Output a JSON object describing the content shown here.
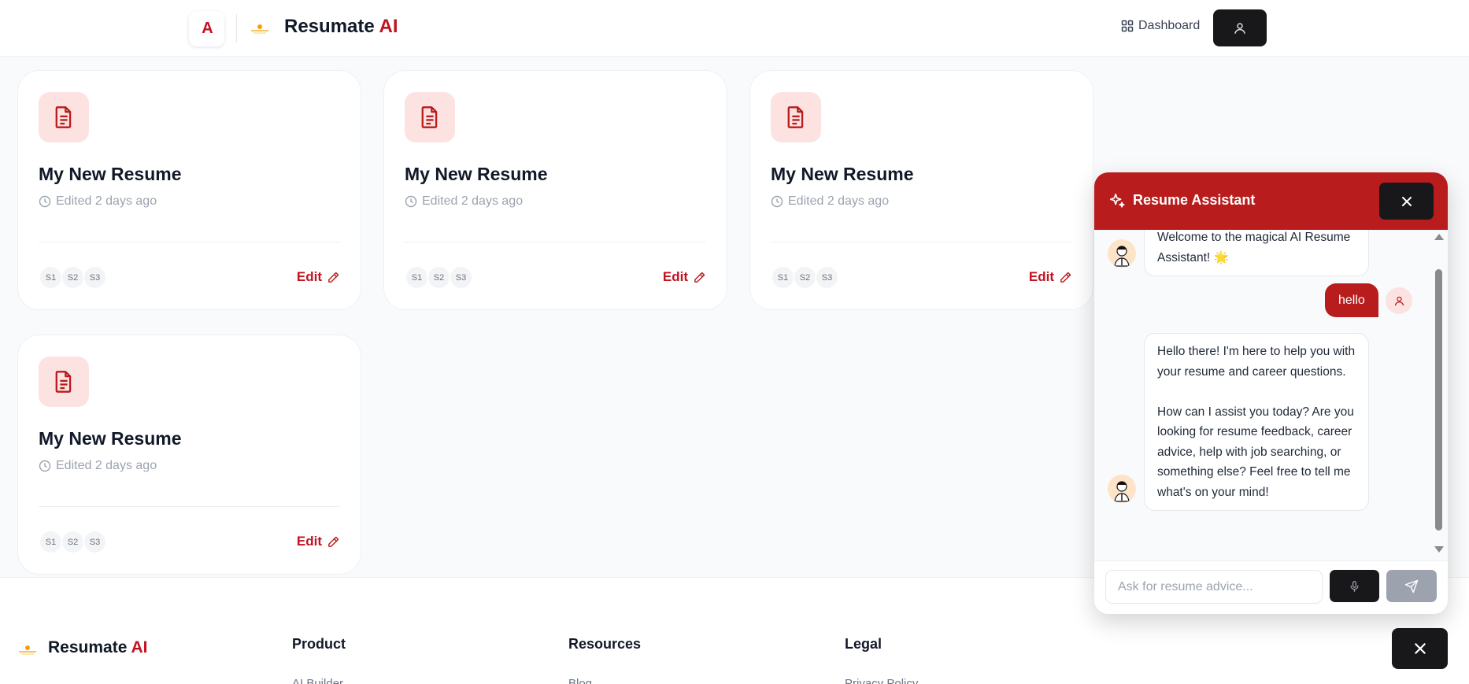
{
  "header": {
    "brand_mark": "A",
    "brand_name": "Resumate",
    "brand_ai": "AI",
    "dashboard_label": "Dashboard"
  },
  "cards": [
    {
      "title": "My New Resume",
      "edited": "Edited 2 days ago",
      "badges": [
        "S1",
        "S2",
        "S3"
      ],
      "edit_label": "Edit"
    },
    {
      "title": "My New Resume",
      "edited": "Edited 2 days ago",
      "badges": [
        "S1",
        "S2",
        "S3"
      ],
      "edit_label": "Edit"
    },
    {
      "title": "My New Resume",
      "edited": "Edited 2 days ago",
      "badges": [
        "S1",
        "S2",
        "S3"
      ],
      "edit_label": "Edit"
    },
    {
      "title": "My New Resume",
      "edited": "Edited 2 days ago",
      "badges": [
        "S1",
        "S2",
        "S3"
      ],
      "edit_label": "Edit"
    }
  ],
  "footer": {
    "brand_name": "Resumate",
    "brand_ai": "AI",
    "columns": [
      {
        "heading": "Product",
        "first_link": "AI Builder"
      },
      {
        "heading": "Resources",
        "first_link": "Blog"
      },
      {
        "heading": "Legal",
        "first_link": "Privacy Policy"
      }
    ]
  },
  "chat": {
    "title": "Resume Assistant",
    "messages": [
      {
        "role": "assistant",
        "text": "Welcome to the magical AI Resume Assistant! 🌟"
      },
      {
        "role": "user",
        "text": "hello"
      },
      {
        "role": "assistant",
        "paragraphs": [
          "Hello there! I'm here to help you with your resume and career questions.",
          "How can I assist you today? Are you looking for resume feedback, career advice, help with job searching, or something else? Feel free to tell me what's on your mind!"
        ]
      }
    ],
    "input_placeholder": "Ask for resume advice..."
  },
  "colors": {
    "accent": "#b91c1c",
    "accent_light": "#fde2e2",
    "dark": "#18181b"
  }
}
